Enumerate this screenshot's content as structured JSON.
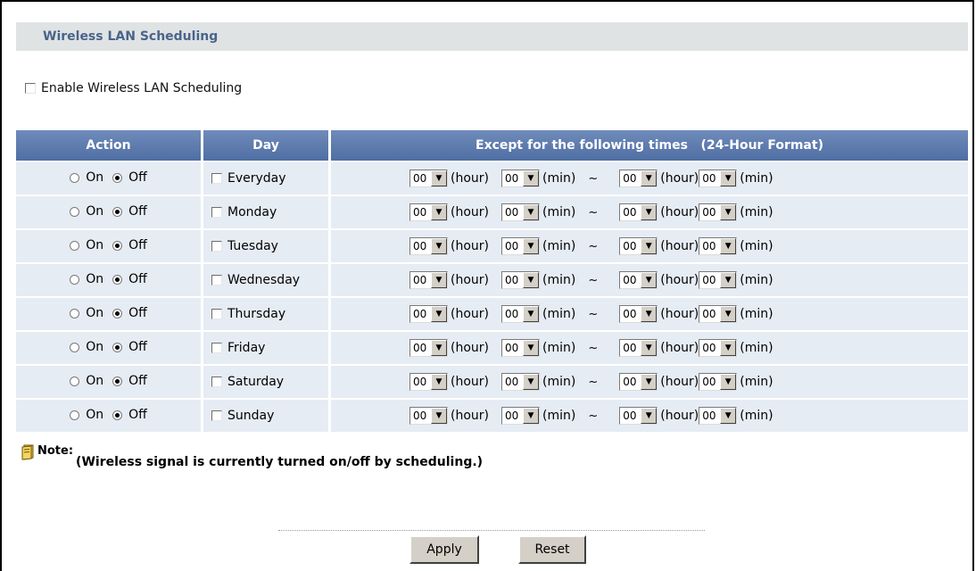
{
  "page": {
    "section_title": "Wireless LAN Scheduling",
    "enable_label": "Enable Wireless LAN Scheduling",
    "enable_checked": false
  },
  "table": {
    "headers": {
      "action": "Action",
      "day": "Day",
      "except": "Except for the following times   (24-Hour Format)"
    },
    "action_on_label": "On",
    "action_off_label": "Off",
    "hour_unit": "(hour)",
    "min_unit": "(min)",
    "separator": "~",
    "rows": [
      {
        "day": "Everyday",
        "action": "Off",
        "start_hour": "00",
        "start_min": "00",
        "end_hour": "00",
        "end_min": "00"
      },
      {
        "day": "Monday",
        "action": "Off",
        "start_hour": "00",
        "start_min": "00",
        "end_hour": "00",
        "end_min": "00"
      },
      {
        "day": "Tuesday",
        "action": "Off",
        "start_hour": "00",
        "start_min": "00",
        "end_hour": "00",
        "end_min": "00"
      },
      {
        "day": "Wednesday",
        "action": "Off",
        "start_hour": "00",
        "start_min": "00",
        "end_hour": "00",
        "end_min": "00"
      },
      {
        "day": "Thursday",
        "action": "Off",
        "start_hour": "00",
        "start_min": "00",
        "end_hour": "00",
        "end_min": "00"
      },
      {
        "day": "Friday",
        "action": "Off",
        "start_hour": "00",
        "start_min": "00",
        "end_hour": "00",
        "end_min": "00"
      },
      {
        "day": "Saturday",
        "action": "Off",
        "start_hour": "00",
        "start_min": "00",
        "end_hour": "00",
        "end_min": "00"
      },
      {
        "day": "Sunday",
        "action": "Off",
        "start_hour": "00",
        "start_min": "00",
        "end_hour": "00",
        "end_min": "00"
      }
    ]
  },
  "note": {
    "label": "Note:",
    "text": "(Wireless signal is currently turned on/off by scheduling.)",
    "icon": "note-icon"
  },
  "buttons": {
    "apply": "Apply",
    "reset": "Reset"
  },
  "colors": {
    "header_bg": "#5a78aa",
    "row_bg": "#e6ecf4",
    "title_bg": "#dfe3e3",
    "title_text": "#4a638c"
  }
}
